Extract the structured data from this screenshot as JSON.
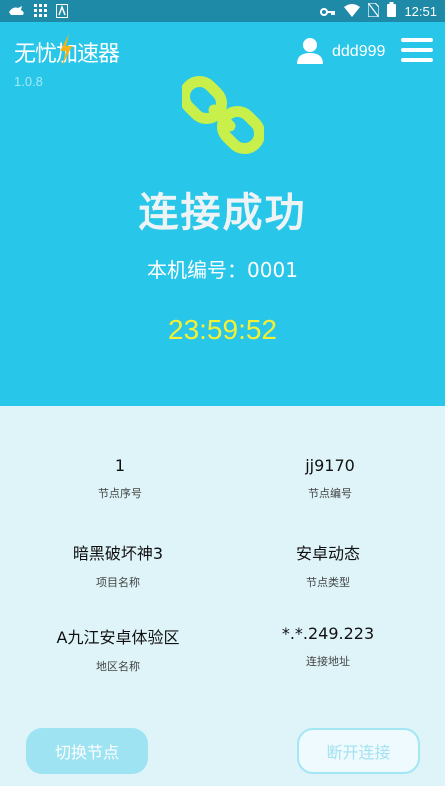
{
  "statusbar": {
    "time": "12:51"
  },
  "app": {
    "logo_text": "无忧加速器",
    "version": "1.0.8"
  },
  "user": {
    "name": "ddd999"
  },
  "connection": {
    "status": "连接成功",
    "machine_label": "本机编号：0001",
    "timer": "23:59:52"
  },
  "info": {
    "node_index_value": "1",
    "node_index_label": "节点序号",
    "node_code_value": "jj9170",
    "node_code_label": "节点编号",
    "project_value": "暗黑破坏神3",
    "project_label": "项目名称",
    "node_type_value": "安卓动态",
    "node_type_label": "节点类型",
    "region_value": "A九江安卓体验区",
    "region_label": "地区名称",
    "address_value": "*.*.249.223",
    "address_label": "连接地址"
  },
  "buttons": {
    "switch_label": "切换节点",
    "disconnect_label": "断开连接"
  },
  "colors": {
    "header_bg": "#28c6e8",
    "content_bg": "#def4f9",
    "timer": "#f5f035",
    "link_icon": "#c8ef4a"
  }
}
